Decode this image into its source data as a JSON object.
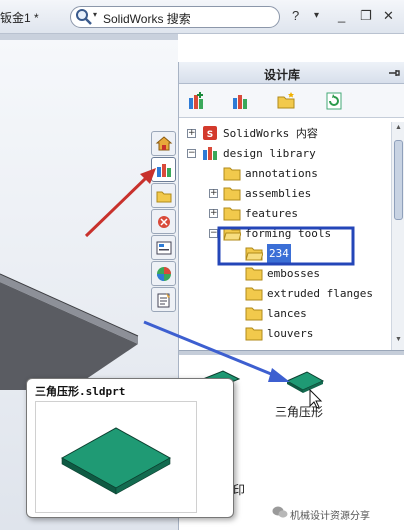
{
  "topbar": {
    "doc_title": "钣金1 *",
    "search_placeholder": "SolidWorks 搜索",
    "help_label": "?",
    "menu_arrow": "▾",
    "minimize": "_",
    "restore": "❐",
    "close": "✕"
  },
  "library": {
    "title": "设计库",
    "tree": [
      {
        "label": "SolidWorks 内容",
        "expander": "+"
      },
      {
        "label": "design library",
        "expander": "−"
      },
      {
        "label": "annotations",
        "expander": ""
      },
      {
        "label": "assemblies",
        "expander": "+"
      },
      {
        "label": "features",
        "expander": "+"
      },
      {
        "label": "forming tools",
        "expander": "−"
      },
      {
        "label": "234",
        "expander": ""
      },
      {
        "label": "embosses",
        "expander": ""
      },
      {
        "label": "extruded flanges",
        "expander": ""
      },
      {
        "label": "lances",
        "expander": ""
      },
      {
        "label": "louvers",
        "expander": ""
      }
    ],
    "preview_item_label": "三角压形",
    "partial_label": "印"
  },
  "tooltip": {
    "title": "三角压形.sldprt"
  },
  "watermark": "机械设计资源分享",
  "colors": {
    "selection": "#3b6fd6",
    "annotation_box": "#2446b8",
    "arrow_red": "#c8312c",
    "arrow_blue": "#3d5fd0",
    "part_green": "#1f9a74"
  }
}
